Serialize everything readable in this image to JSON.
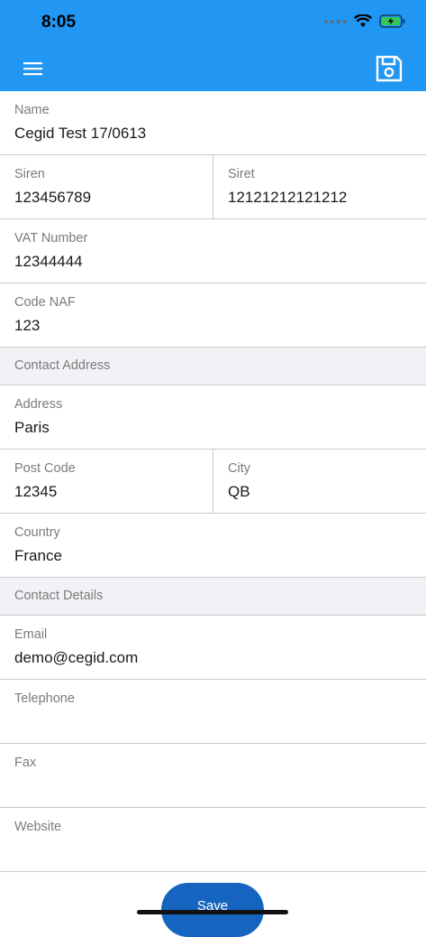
{
  "status_bar": {
    "time": "8:05"
  },
  "header": {
    "menu_icon": "hamburger-menu-icon",
    "save_icon": "floppy-disk-icon",
    "color": "#2196f3"
  },
  "fields": {
    "name": {
      "label": "Name",
      "value": "Cegid Test 17/0613"
    },
    "siren": {
      "label": "Siren",
      "value": "123456789"
    },
    "siret": {
      "label": "Siret",
      "value": "12121212121212"
    },
    "vat": {
      "label": "VAT Number",
      "value": "12344444"
    },
    "naf": {
      "label": "Code NAF",
      "value": "123"
    },
    "address": {
      "label": "Address",
      "value": "Paris"
    },
    "postcode": {
      "label": "Post Code",
      "value": "12345"
    },
    "city": {
      "label": "City",
      "value": "QB"
    },
    "country": {
      "label": "Country",
      "value": "France"
    },
    "email": {
      "label": "Email",
      "value": "demo@cegid.com"
    },
    "telephone": {
      "label": "Telephone",
      "value": ""
    },
    "fax": {
      "label": "Fax",
      "value": ""
    },
    "website": {
      "label": "Website",
      "value": ""
    }
  },
  "sections": {
    "contact_address": "Contact Address",
    "contact_details": "Contact Details"
  },
  "footer": {
    "save_label": "Save",
    "button_color": "#1565c0"
  }
}
